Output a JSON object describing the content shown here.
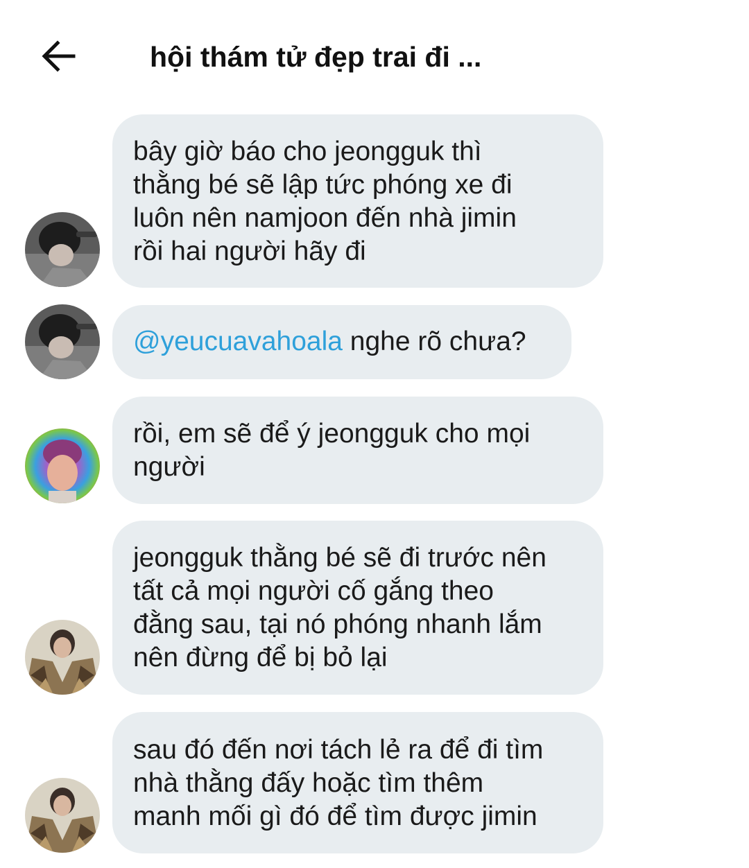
{
  "header": {
    "title": "hội thám tử đẹp trai đi ..."
  },
  "messages": [
    {
      "lines": [
        "bây giờ báo cho jeongguk thì",
        "thằng bé sẽ lập tức phóng xe đi",
        "luôn nên namjoon đến nhà jimin",
        "rồi hai người hãy đi"
      ]
    },
    {
      "mention": "@yeucuavahoala",
      "text": " nghe rõ chưa?"
    },
    {
      "lines": [
        "rồi, em sẽ để ý jeongguk cho mọi",
        "người"
      ]
    },
    {
      "lines": [
        "jeongguk thằng bé sẽ đi trước nên",
        "tất cả mọi người cố gắng theo",
        "đằng sau, tại nó phóng nhanh lắm",
        "nên đừng để bị bỏ lại"
      ]
    },
    {
      "lines": [
        "sau đó đến nơi tách lẻ ra để đi tìm",
        "nhà thằng đấy hoặc tìm thêm",
        "manh mối gì đó để tìm được jimin"
      ]
    }
  ],
  "colors": {
    "bubble_bg": "#e8edf0",
    "mention": "#2ea0da",
    "text": "#1a1a1a"
  },
  "icons": {
    "back": "arrow-left-icon"
  }
}
